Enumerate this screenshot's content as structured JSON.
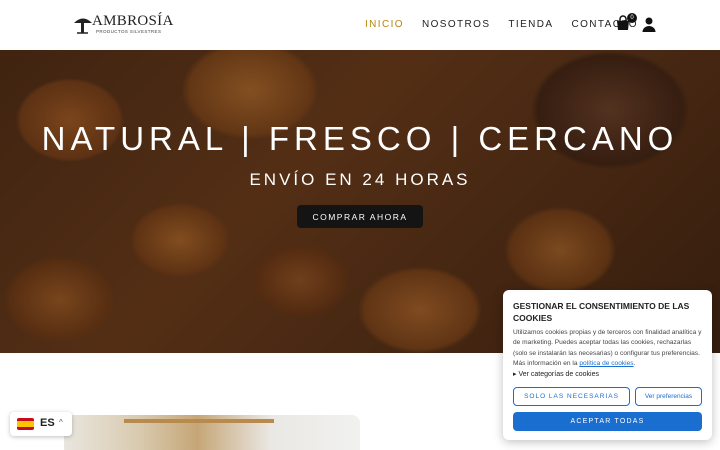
{
  "header": {
    "logo": {
      "name": "AMBROSÍA",
      "tagline": "PRODUCTOS SILVESTRES"
    },
    "nav": [
      {
        "label": "INICIO",
        "active": true
      },
      {
        "label": "NOSOTROS",
        "active": false
      },
      {
        "label": "TIENDA",
        "active": false
      },
      {
        "label": "CONTACTO",
        "active": false
      }
    ],
    "cart_count": "0",
    "cart_icon": "shopping-bag-icon",
    "account_icon": "user-icon",
    "accent_color": "#b8860b"
  },
  "hero": {
    "title": "NATURAL | FRESCO | CERCANO",
    "subtitle": "ENVÍO EN 24 HORAS",
    "cta_label": "COMPRAR AHORA"
  },
  "language": {
    "code": "ES",
    "flag": "spain-flag-icon"
  },
  "cookies": {
    "title": "GESTIONAR EL CONSENTIMIENTO DE LAS COOKIES",
    "text": "Utilizamos cookies propias y de terceros con finalidad analítica y de marketing. Puedes aceptar todas las cookies, rechazarlas (solo se instalarán las necesarias) o configurar tus preferencias. Más información en la ",
    "link_label": "política de cookies",
    "text_end": ".",
    "categories_label": "▸ Ver categorías de cookies",
    "necessary_label": "SOLO LAS NECESARIAS",
    "preferences_label": "Ver preferencias",
    "accept_label": "ACEPTAR TODAS",
    "accent_color": "#1a6ecf"
  }
}
